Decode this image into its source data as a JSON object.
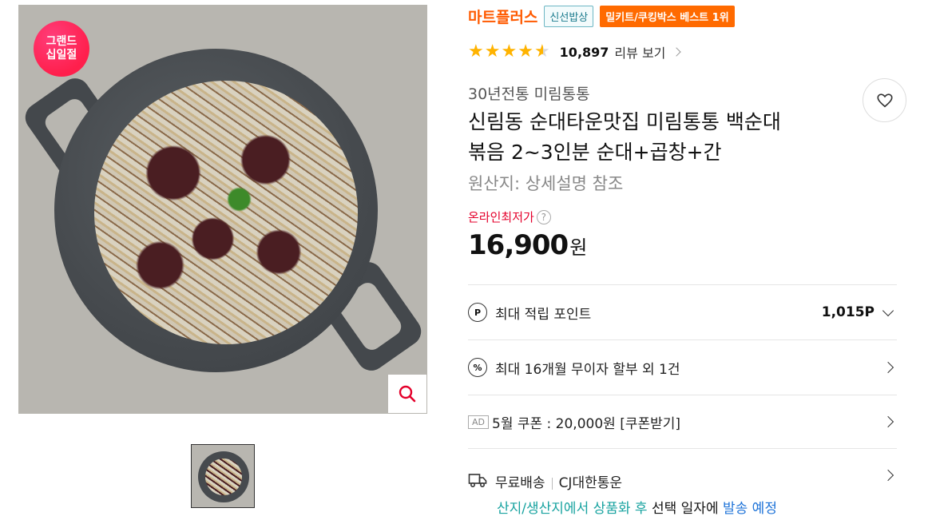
{
  "product_image": {
    "badge_line1": "그랜드",
    "badge_line2": "십일절",
    "zoom_icon": "magnifier-icon"
  },
  "brand": {
    "name": "마트플러스",
    "tag_fresh": "신선밥상",
    "tag_best": "밀키트/쿠킹박스 베스트 1위"
  },
  "rating": {
    "stars": 4.5,
    "count": "10,897",
    "review_link": "리뷰 보기"
  },
  "seller": "30년전통 미림통통",
  "title_line1": "신림동 순대타운맛집 미림통통 백순대",
  "title_line2": "볶음 2~3인분 순대+곱창+간",
  "origin": "원산지:  상세설명 참조",
  "price": {
    "label": "온라인최저가",
    "help": "?",
    "amount": "16,900",
    "unit": "원"
  },
  "benefits": {
    "points_icon": "P",
    "points_label": "최대 적립 포인트",
    "points_value": "1,015P",
    "installment_icon": "%",
    "installment_label": "최대 16개월 무이자 할부 외 1건",
    "ad_tag": "AD",
    "coupon_label": "5월 쿠폰 : 20,000원 [쿠폰받기]"
  },
  "shipping": {
    "label": "무료배송",
    "carrier": "CJ대한통운",
    "note_teal": "산지/생산지에서 상품화 후",
    "note_plain": " 선택 일자에 ",
    "note_blue": "발송 예정"
  },
  "colors": {
    "brand": "#ff5a00",
    "price_label": "#e4002b",
    "teal": "#18a3a0",
    "blue": "#1e73d8",
    "star": "#ffb300"
  }
}
